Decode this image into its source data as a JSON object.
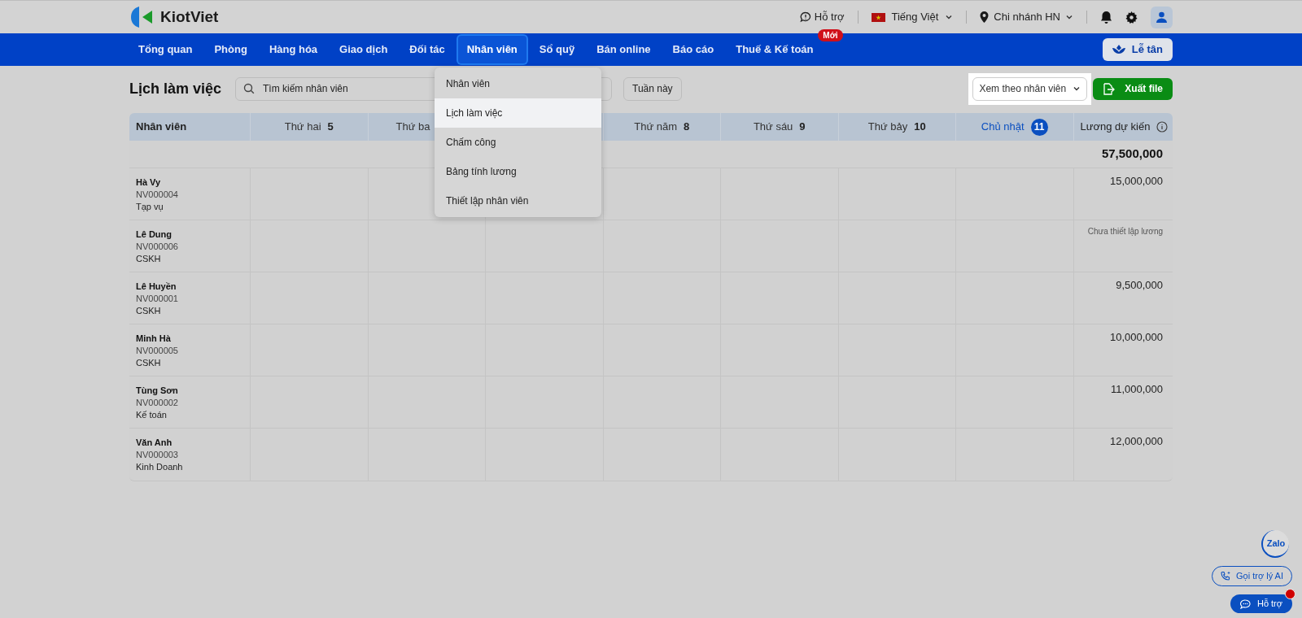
{
  "header": {
    "logo": "KiotViet",
    "support": "Hỗ trợ",
    "language": "Tiếng Việt",
    "branch": "Chi nhánh HN"
  },
  "nav": {
    "items": [
      {
        "label": "Tổng quan",
        "selected": false
      },
      {
        "label": "Phòng",
        "selected": false
      },
      {
        "label": "Hàng hóa",
        "selected": false
      },
      {
        "label": "Giao dịch",
        "selected": false
      },
      {
        "label": "Đối tác",
        "selected": false
      },
      {
        "label": "Nhân viên",
        "selected": true
      },
      {
        "label": "Sổ quỹ",
        "selected": false
      },
      {
        "label": "Bán online",
        "selected": false
      },
      {
        "label": "Báo cáo",
        "selected": false
      },
      {
        "label": "Thuế & Kế toán",
        "selected": false,
        "badge": "Mới"
      }
    ],
    "reception_button": "Lễ tân"
  },
  "dropdown_menu": {
    "items": [
      {
        "label": "Nhân viên",
        "selected": false
      },
      {
        "label": "Lịch làm việc",
        "selected": true
      },
      {
        "label": "Chấm công",
        "selected": false
      },
      {
        "label": "Bảng tính lương",
        "selected": false
      },
      {
        "label": "Thiết lập nhân viên",
        "selected": false
      }
    ]
  },
  "toolbar": {
    "title": "Lịch làm việc",
    "search_placeholder": "Tìm kiếm nhân viên",
    "week_button": "Tuần này",
    "view_select": "Xem theo nhân viên",
    "export_button": "Xuất file"
  },
  "table": {
    "employee_column": "Nhân viên",
    "salary_column": "Lương dự kiến",
    "days": [
      {
        "label": "Thứ hai",
        "date": "5",
        "today": false
      },
      {
        "label": "Thứ ba",
        "today": false
      },
      {
        "label": "Thứ năm",
        "date": "8",
        "today": false
      },
      {
        "label": "Thứ sáu",
        "date": "9",
        "today": false
      },
      {
        "label": "Thứ bảy",
        "date": "10",
        "today": false
      },
      {
        "label": "Chủ nhật",
        "date": "11",
        "today": true
      }
    ],
    "total": "57,500,000",
    "rows": [
      {
        "name": "Hà Vy",
        "code": "NV000004",
        "role": "Tạp vụ",
        "salary": "15,000,000",
        "kind": "amount"
      },
      {
        "name": "Lê Dung",
        "code": "NV000006",
        "role": "CSKH",
        "salary": "Chưa thiết lập lương",
        "kind": "not_set"
      },
      {
        "name": "Lê Huyền",
        "code": "NV000001",
        "role": "CSKH",
        "salary": "9,500,000",
        "kind": "amount"
      },
      {
        "name": "Minh Hà",
        "code": "NV000005",
        "role": "CSKH",
        "salary": "10,000,000",
        "kind": "amount"
      },
      {
        "name": "Tùng Sơn",
        "code": "NV000002",
        "role": "Kế toán",
        "salary": "11,000,000",
        "kind": "amount"
      },
      {
        "name": "Văn Anh",
        "code": "NV000003",
        "role": "Kinh Doanh",
        "salary": "12,000,000",
        "kind": "amount"
      }
    ]
  },
  "floating": {
    "zalo": "Zalo",
    "ai_button": "Gọi trợ lý AI",
    "support_button": "Hỗ trợ",
    "notification": true
  }
}
